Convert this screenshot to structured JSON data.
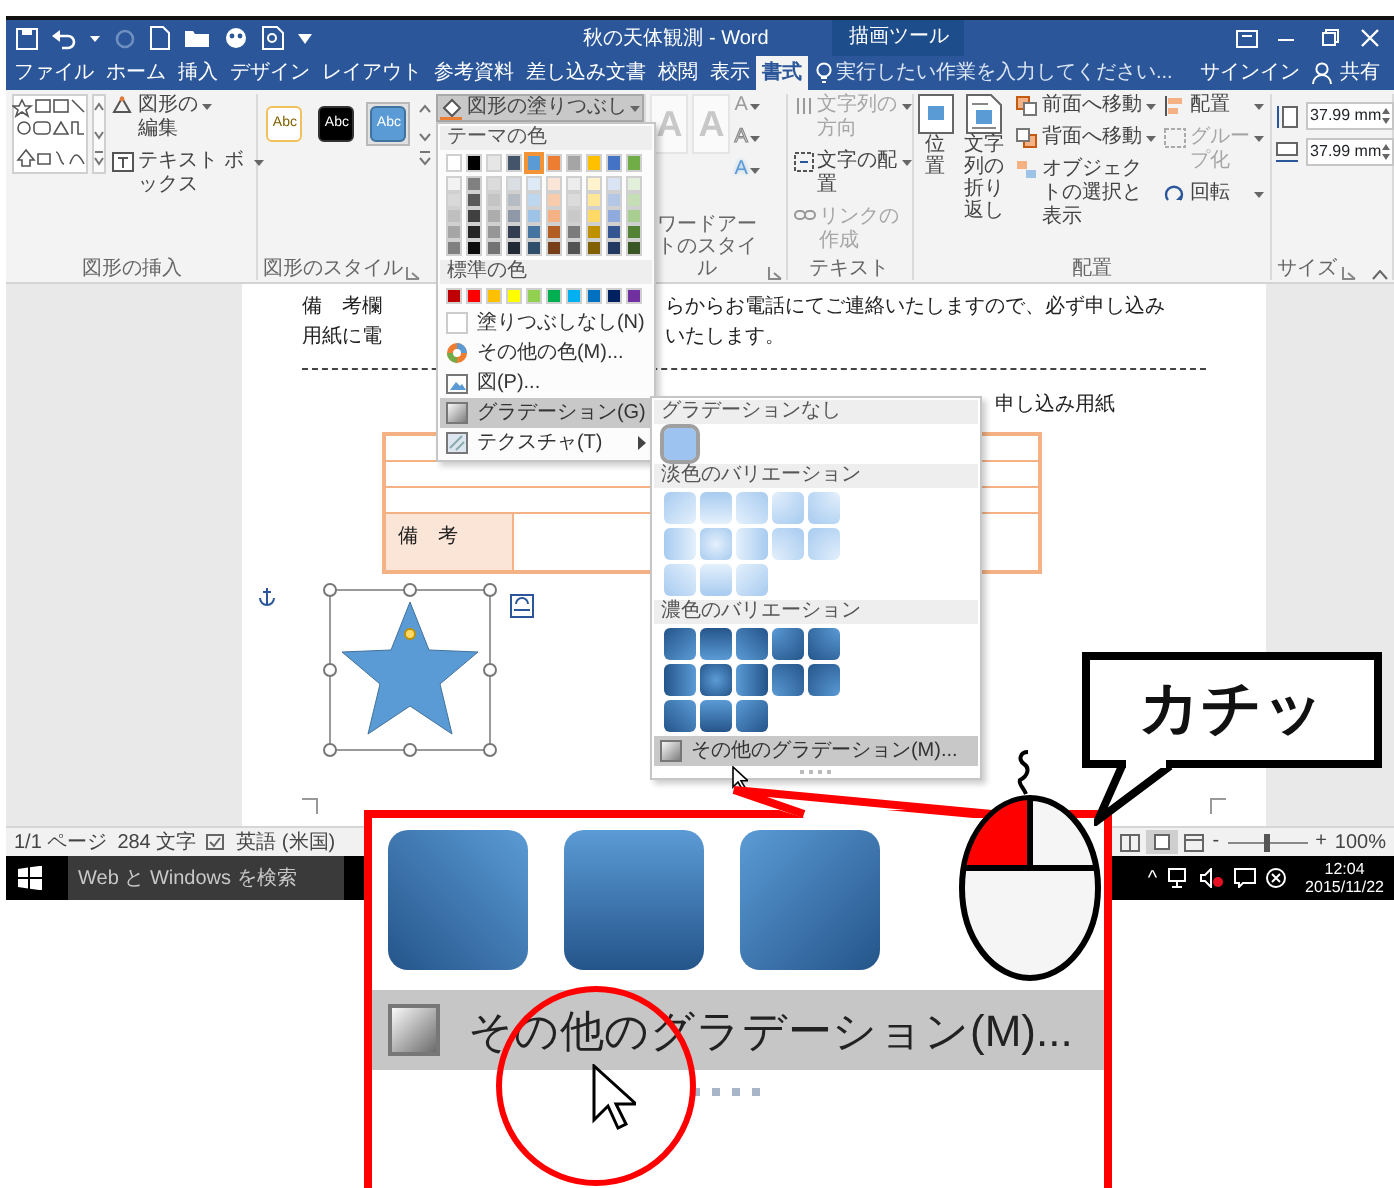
{
  "window": {
    "title": "秋の天体観測 - Word",
    "context_tab": "描画ツール",
    "tabs": [
      {
        "label": "ファイル",
        "selected": false
      },
      {
        "label": "ホーム",
        "selected": false
      },
      {
        "label": "挿入",
        "selected": false
      },
      {
        "label": "デザイン",
        "selected": false
      },
      {
        "label": "レイアウト",
        "selected": false
      },
      {
        "label": "参考資料",
        "selected": false
      },
      {
        "label": "差し込み文書",
        "selected": false
      },
      {
        "label": "校閲",
        "selected": false
      },
      {
        "label": "表示",
        "selected": false
      },
      {
        "label": "書式",
        "selected": true
      }
    ],
    "tell_me": {
      "placeholder": "実行したい作業を入力してください..."
    },
    "signin": "サインイン",
    "share": "共有"
  },
  "ribbon": {
    "groups": [
      {
        "kind": "insert-shapes",
        "label": "図形の挿入",
        "buttons": [
          "図形の編集",
          "テキスト ボックス"
        ]
      },
      {
        "kind": "shape-styles",
        "label": "図形のスタイル",
        "styles": [
          {
            "label": "Abc",
            "kind": "outline",
            "selected": false
          },
          {
            "label": "Abc",
            "kind": "dark",
            "selected": false
          },
          {
            "label": "Abc",
            "kind": "blue",
            "selected": true
          }
        ],
        "fill_button": {
          "label": "図形の塗りつぶし",
          "open": true
        }
      },
      {
        "kind": "wordart",
        "label": "ワードアートのスタイル",
        "letters": [
          "A",
          "A"
        ],
        "small": [
          {
            "label": "A",
            "kind": "fill"
          },
          {
            "label": "A",
            "kind": "outline"
          },
          {
            "label": "A",
            "kind": "effects"
          }
        ]
      },
      {
        "kind": "text",
        "label": "テキスト",
        "buttons": [
          {
            "label": "文字列の方向",
            "disabled": true
          },
          {
            "label": "文字の配置",
            "disabled": false
          },
          {
            "label": "リンクの作成",
            "disabled": true
          }
        ]
      },
      {
        "kind": "arrange",
        "label": "配置",
        "large": [
          "位置",
          "文字列の折り返し"
        ],
        "small": [
          {
            "label": "前面へ移動",
            "disabled": false
          },
          {
            "label": "背面へ移動",
            "disabled": false
          },
          {
            "label": "オブジェクトの選択と表示",
            "disabled": false
          },
          {
            "label": "配置",
            "disabled": false
          },
          {
            "label": "グループ化",
            "disabled": true
          },
          {
            "label": "回転",
            "disabled": false
          }
        ]
      },
      {
        "kind": "size",
        "label": "サイズ",
        "fields": [
          "37.99 mm",
          "37.99 mm"
        ]
      }
    ]
  },
  "fill_menu": {
    "theme_header": "テーマの色",
    "theme_colors": [
      {
        "color": "#ffffff",
        "selected": false
      },
      {
        "color": "#000000",
        "selected": false
      },
      {
        "color": "#e7e6e6",
        "selected": false
      },
      {
        "color": "#44546a",
        "selected": false
      },
      {
        "color": "#5b9bd5",
        "selected": true
      },
      {
        "color": "#ed7d31",
        "selected": false
      },
      {
        "color": "#a5a5a5",
        "selected": false
      },
      {
        "color": "#ffc000",
        "selected": false
      },
      {
        "color": "#4472c4",
        "selected": false
      },
      {
        "color": "#70ad47",
        "selected": false
      }
    ],
    "standard_header": "標準の色",
    "standard_colors": [
      {
        "color": "#c00000"
      },
      {
        "color": "#ff0000"
      },
      {
        "color": "#ffc000"
      },
      {
        "color": "#ffff00"
      },
      {
        "color": "#92d050"
      },
      {
        "color": "#00b050"
      },
      {
        "color": "#00b0f0"
      },
      {
        "color": "#0070c0"
      },
      {
        "color": "#002060"
      },
      {
        "color": "#7030a0"
      }
    ],
    "items": [
      {
        "label": "塗りつぶしなし(N)",
        "kind": "none",
        "submenu": false,
        "highlighted": false
      },
      {
        "label": "その他の色(M)...",
        "kind": "palette",
        "submenu": false,
        "highlighted": false
      },
      {
        "label": "図(P)...",
        "kind": "picture",
        "submenu": false,
        "highlighted": false
      },
      {
        "label": "グラデーション(G)",
        "kind": "gradient",
        "submenu": true,
        "highlighted": true
      },
      {
        "label": "テクスチャ(T)",
        "kind": "texture",
        "submenu": true,
        "highlighted": false
      }
    ]
  },
  "gradient_menu": {
    "sections": [
      {
        "header": "グラデーションなし",
        "kind": "none",
        "swatches": [
          {
            "kind": "solid",
            "selected": true
          }
        ]
      },
      {
        "header": "淡色のバリエーション",
        "kind": "light",
        "swatches": [
          {
            "kind": "diag-tl",
            "selected": false
          },
          {
            "kind": "down",
            "selected": false
          },
          {
            "kind": "diag-tr",
            "selected": false
          },
          {
            "kind": "corner-tl",
            "selected": false
          },
          {
            "kind": "corner-tr",
            "selected": false
          },
          {
            "kind": "right",
            "selected": false
          },
          {
            "kind": "center",
            "selected": false
          },
          {
            "kind": "left",
            "selected": false
          },
          {
            "kind": "corner-bl",
            "selected": false
          },
          {
            "kind": "corner-br",
            "selected": false
          },
          {
            "kind": "diag-bl",
            "selected": false
          },
          {
            "kind": "up",
            "selected": false
          },
          {
            "kind": "diag-br",
            "selected": false
          }
        ]
      },
      {
        "header": "濃色のバリエーション",
        "kind": "dark",
        "swatches": [
          {
            "kind": "diag-tl",
            "selected": false
          },
          {
            "kind": "down",
            "selected": false
          },
          {
            "kind": "diag-tr",
            "selected": false
          },
          {
            "kind": "corner-tl",
            "selected": false
          },
          {
            "kind": "corner-tr",
            "selected": false
          },
          {
            "kind": "right",
            "selected": false
          },
          {
            "kind": "center",
            "selected": false
          },
          {
            "kind": "left",
            "selected": false
          },
          {
            "kind": "corner-bl",
            "selected": false
          },
          {
            "kind": "corner-br",
            "selected": false
          },
          {
            "kind": "diag-bl",
            "selected": false
          },
          {
            "kind": "up",
            "selected": false
          },
          {
            "kind": "diag-br",
            "selected": false
          }
        ]
      }
    ],
    "more": {
      "label": "その他のグラデーション(M)...",
      "highlighted": true
    }
  },
  "document": {
    "lines": [
      {
        "segments": [
          "備　考欄",
          "らからお電話にてご連絡いたしますので、必ず申し込み"
        ]
      },
      {
        "segments": [
          "用紙に電",
          "いたします。"
        ]
      }
    ],
    "form_title": "申し込み用紙",
    "cell_text": "備　考"
  },
  "status_bar": {
    "items": [
      "1/1 ページ",
      "284 文字",
      "英語 (米国)"
    ],
    "zoom": {
      "minus": "-",
      "plus": "+",
      "level": 0.5,
      "value": "100%"
    }
  },
  "taskbar": {
    "search": {
      "placeholder": "Web と Windows を検索"
    },
    "tray_chevron": "^",
    "time": "12:04",
    "date": "2015/11/22"
  },
  "callout": {
    "kind": "dark",
    "swatches": [
      {
        "kind": "diag-bl"
      },
      {
        "kind": "up"
      },
      {
        "kind": "diag-br"
      }
    ],
    "item": "その他のグラデーション(M)...",
    "sound": "カチッ"
  }
}
